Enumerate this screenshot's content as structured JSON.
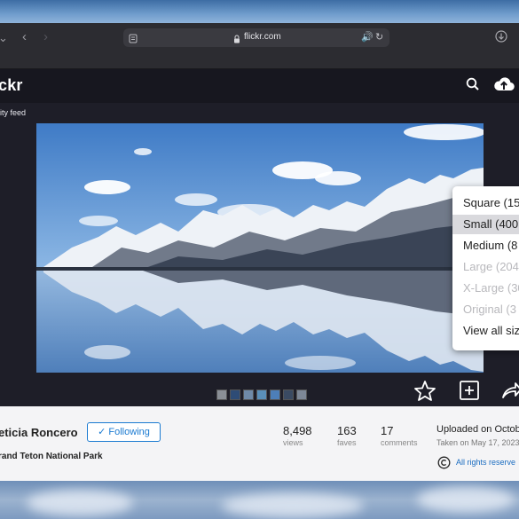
{
  "browser": {
    "url": "flickr.com"
  },
  "header": {
    "logo": "ckr"
  },
  "nav": {
    "back_link": "ity feed"
  },
  "photo": {
    "owner": "eticia Roncero",
    "follow_label": "Following",
    "follow_check": "✓",
    "title": "rand Teton National Park",
    "stats": [
      {
        "value": "8,498",
        "label": "views"
      },
      {
        "value": "163",
        "label": "faves"
      },
      {
        "value": "17",
        "label": "comments"
      }
    ],
    "uploaded": "Uploaded on Octob",
    "taken": "Taken on May 17, 2023",
    "rights": "All rights reserve"
  },
  "size_menu": {
    "items": [
      {
        "label": "Square (15",
        "state": "enabled"
      },
      {
        "label": "Small (400",
        "state": "selected"
      },
      {
        "label": "Medium (8",
        "state": "enabled"
      },
      {
        "label": "Large (204",
        "state": "disabled"
      },
      {
        "label": "X-Large (30",
        "state": "disabled"
      },
      {
        "label": "Original (3",
        "state": "disabled"
      },
      {
        "label": "View all siz",
        "state": "enabled"
      }
    ]
  },
  "colors": {
    "accent": "#1a7ad1",
    "browser_chrome": "#2c2c31",
    "page_dark": "#1e1e28",
    "info_bar": "#f4f4f6"
  },
  "icons": {
    "sidebar": "sidebar-toggle-icon",
    "back": "back-arrow-icon",
    "forward": "forward-arrow-icon",
    "reader": "reader-icon",
    "lock": "lock-icon",
    "audio": "audio-icon",
    "reload": "reload-icon",
    "downloads": "download-icon",
    "search": "search-icon",
    "upload": "upload-cloud-icon",
    "fave": "star-icon",
    "add": "add-to-gallery-icon",
    "share": "share-icon",
    "rights": "copyright-icon"
  }
}
